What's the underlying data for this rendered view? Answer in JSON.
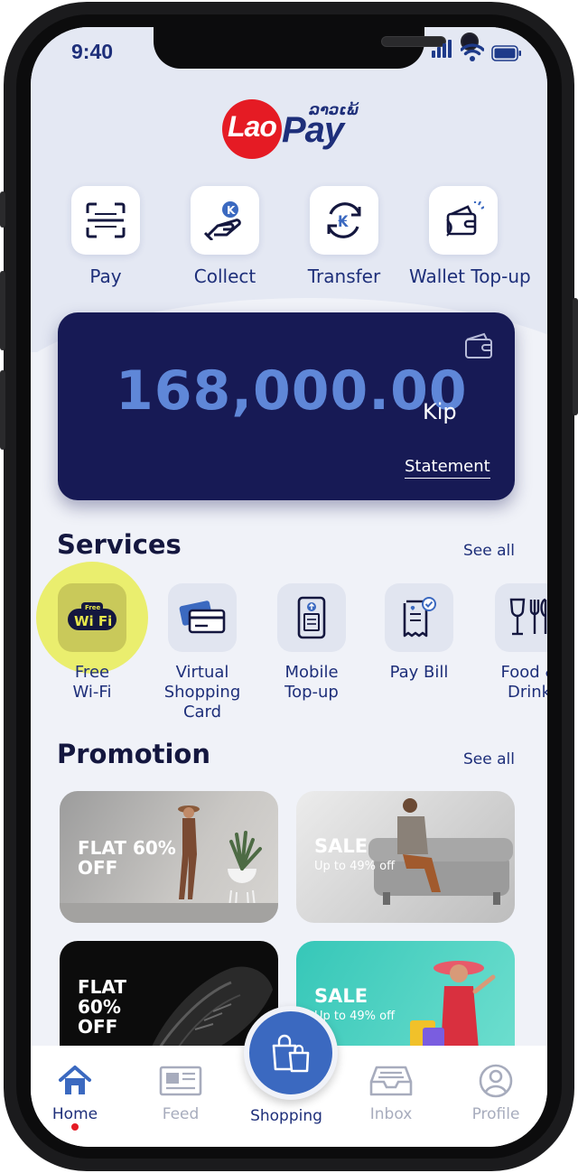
{
  "status_bar": {
    "time": "9:40"
  },
  "brand": {
    "lao": "Lao",
    "pay": "Pay",
    "script": "ລາວເພ້"
  },
  "quick_actions": [
    {
      "label": "Pay",
      "icon": "scan-icon"
    },
    {
      "label": "Collect",
      "icon": "collect-icon"
    },
    {
      "label": "Transfer",
      "icon": "transfer-icon"
    },
    {
      "label": "Wallet Top-up",
      "icon": "wallet-topup-icon"
    }
  ],
  "balance": {
    "amount": "168,000.00",
    "unit": "Kip",
    "statement_label": "Statement",
    "icon": "wallet-icon"
  },
  "services": {
    "title": "Services",
    "see_all": "See all",
    "items": [
      {
        "label": "Free\nWi-Fi",
        "icon": "wifi-icon",
        "icon_text": "Wi Fi",
        "icon_subtext": "Free"
      },
      {
        "label": "Virtual\nShopping\nCard",
        "icon": "cards-icon"
      },
      {
        "label": "Mobile\nTop-up",
        "icon": "mobile-icon"
      },
      {
        "label": "Pay Bill",
        "icon": "bill-icon"
      },
      {
        "label": "Food &\nDrink",
        "icon": "food-drink-icon"
      }
    ]
  },
  "promotion": {
    "title": "Promotion",
    "see_all": "See all",
    "items": [
      {
        "headline": "FLAT 60%\nOFF",
        "sub": ""
      },
      {
        "headline": "SALE",
        "sub": "Up to 49% off"
      },
      {
        "headline": "FLAT\n60%\nOFF",
        "sub": ""
      },
      {
        "headline": "SALE",
        "sub": "Up to 49% off"
      }
    ]
  },
  "tabbar": {
    "items": [
      {
        "label": "Home",
        "icon": "home-icon",
        "active": true
      },
      {
        "label": "Feed",
        "icon": "feed-icon",
        "active": false
      },
      {
        "label": "Shopping",
        "icon": "shopping-bag-icon",
        "active": false
      },
      {
        "label": "Inbox",
        "icon": "inbox-icon",
        "active": false
      },
      {
        "label": "Profile",
        "icon": "profile-icon",
        "active": false
      }
    ]
  },
  "colors": {
    "brand_navy": "#1e2f7a",
    "brand_red": "#e51b24",
    "card_bg": "#171a55",
    "amount_blue": "#5f87d8",
    "fab_blue": "#3b69c0"
  }
}
